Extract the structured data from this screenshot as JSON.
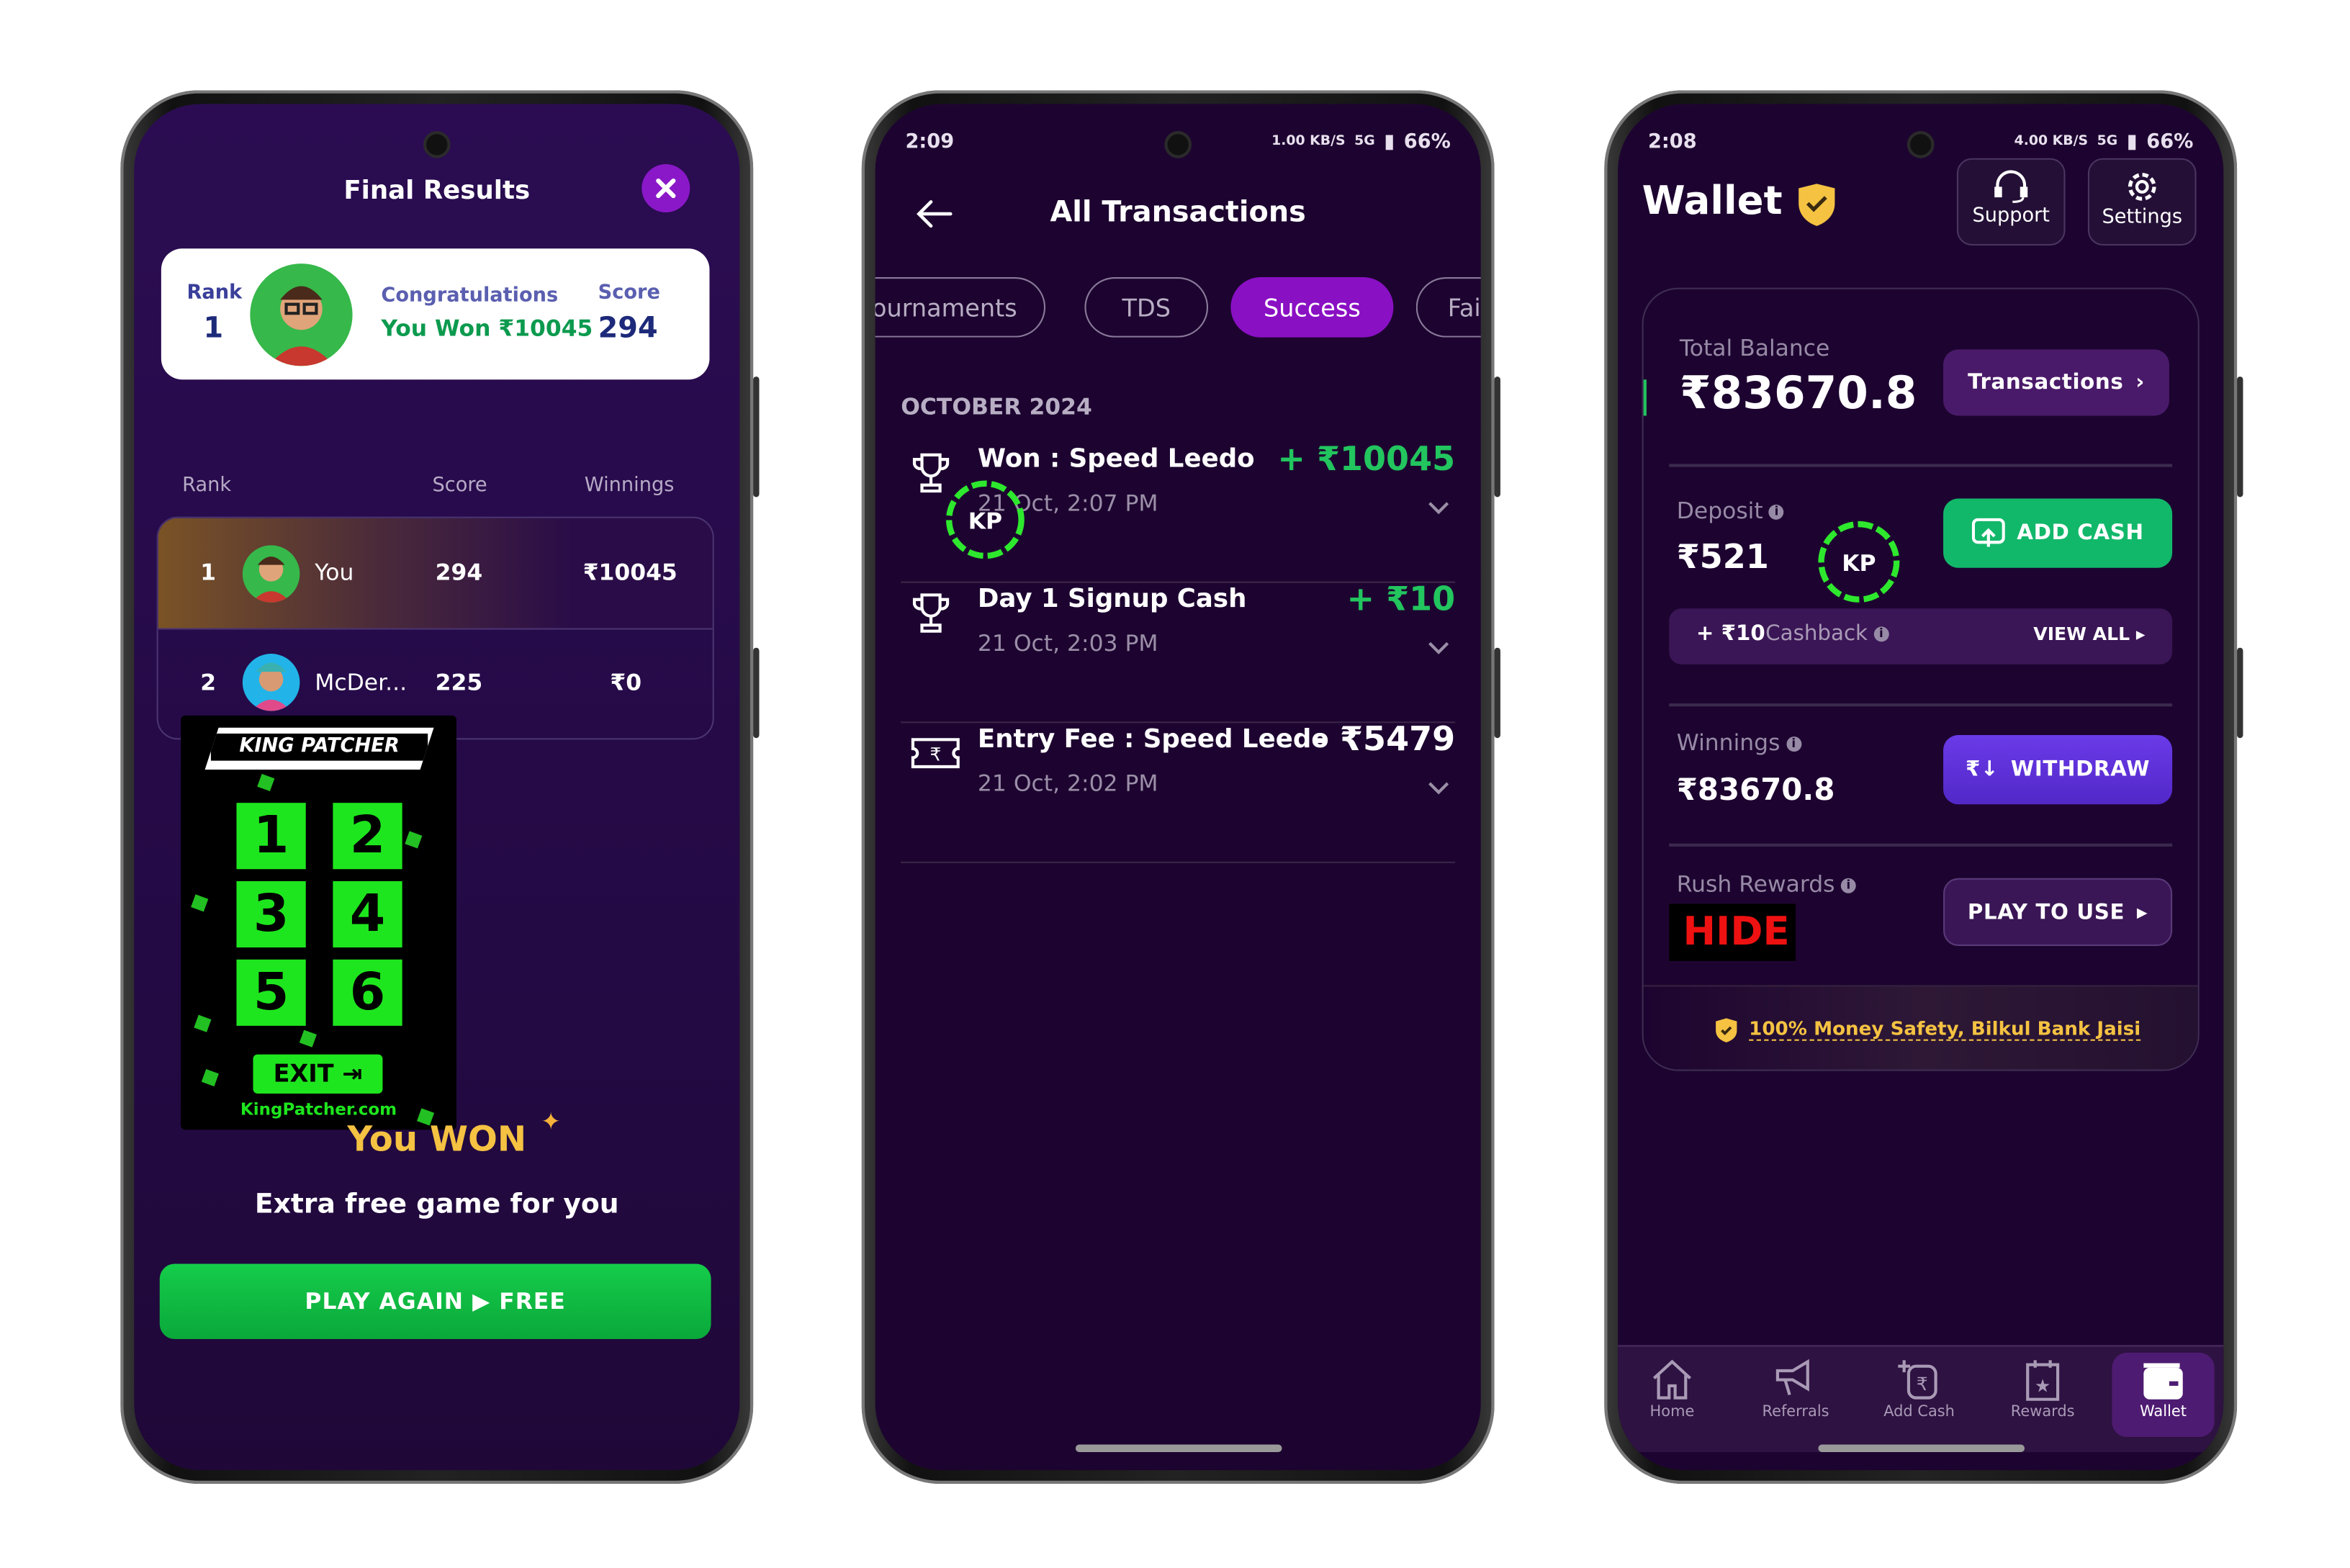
{
  "phone1": {
    "title": "Final Results",
    "card": {
      "rank_label": "Rank",
      "rank": "1",
      "congrats": "Congratulations",
      "won": "You Won ₹10045",
      "score_label": "Score",
      "score": "294"
    },
    "table": {
      "headers": [
        "Rank",
        "Score",
        "Winnings"
      ],
      "rows": [
        {
          "rank": "1",
          "name": "You",
          "score": "294",
          "winnings": "₹10045"
        },
        {
          "rank": "2",
          "name": "McDer...",
          "score": "225",
          "winnings": "₹0"
        }
      ]
    },
    "overlay": {
      "brand": "KING PATCHER",
      "buttons": [
        "1",
        "2",
        "3",
        "4",
        "5",
        "6"
      ],
      "exit": "EXIT",
      "site": "KingPatcher.com"
    },
    "you_won": "You WON",
    "extra": "Extra free game for you",
    "play_again": "PLAY AGAIN ▶ FREE"
  },
  "phone2": {
    "status": {
      "time": "2:09",
      "speed": "1.00 KB/S",
      "net": "5G",
      "battery": "66%"
    },
    "title": "All Transactions",
    "tabs": [
      {
        "label": "ournaments",
        "active": false
      },
      {
        "label": "TDS",
        "active": false
      },
      {
        "label": "Success",
        "active": true
      },
      {
        "label": "Fai",
        "active": false
      }
    ],
    "month": "OCTOBER 2024",
    "transactions": [
      {
        "title": "Won : Speed Leedo",
        "date": "21 Oct, 2:07 PM",
        "amount": "+ ₹10045",
        "icon": "trophy-icon",
        "type": "credit"
      },
      {
        "title": "Day 1 Signup Cash",
        "date": "21 Oct, 2:03 PM",
        "amount": "+ ₹10",
        "icon": "trophy-icon",
        "type": "credit"
      },
      {
        "title": "Entry Fee : Speed Leedo",
        "date": "21 Oct, 2:02 PM",
        "amount": "- ₹5479",
        "icon": "ticket-rupee-icon",
        "type": "debit"
      }
    ]
  },
  "phone3": {
    "status": {
      "time": "2:08",
      "speed": "4.00 KB/S",
      "net": "5G",
      "battery": "66%"
    },
    "title": "Wallet",
    "support": "Support",
    "settings": "Settings",
    "total_label": "Total Balance",
    "total": "₹83670.8",
    "transactions_btn": "Transactions",
    "deposit_label": "Deposit",
    "deposit": "₹521",
    "add_cash": "ADD CASH",
    "cashback_amount": "+ ₹10",
    "cashback_label": "Cashback",
    "view_all": "VIEW ALL",
    "winnings_label": "Winnings",
    "winnings": "₹83670.8",
    "withdraw": "WITHDRAW",
    "rush_label": "Rush Rewards",
    "hide": "HIDE",
    "play_to_use": "PLAY TO USE",
    "safety": "100% Money Safety, Bilkul Bank Jaisi",
    "nav": [
      {
        "label": "Home",
        "icon": "home-icon",
        "active": false
      },
      {
        "label": "Referrals",
        "icon": "megaphone-icon",
        "active": false
      },
      {
        "label": "Add Cash",
        "icon": "add-rupee-icon",
        "active": false
      },
      {
        "label": "Rewards",
        "icon": "calendar-star-icon",
        "active": false
      },
      {
        "label": "Wallet",
        "icon": "wallet-icon",
        "active": true
      }
    ]
  },
  "colors": {
    "green": "#1fc35a",
    "purple_active": "#8a10c4",
    "withdraw": "#5a2fd8",
    "gold": "#f5c242",
    "bg": "#1d0430"
  }
}
